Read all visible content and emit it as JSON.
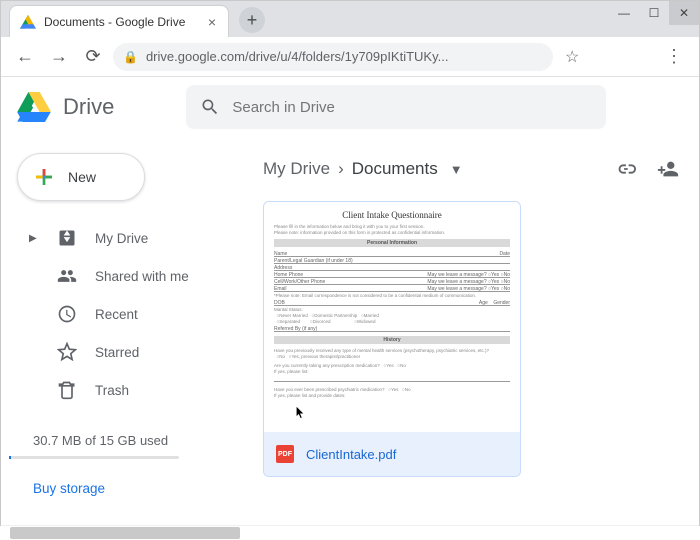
{
  "browser": {
    "tab_title": "Documents - Google Drive",
    "url": "drive.google.com/drive/u/4/folders/1y709pIKtiTUKy...",
    "new_tab_glyph": "+",
    "tab_close_glyph": "×"
  },
  "app": {
    "name": "Drive",
    "search_placeholder": "Search in Drive"
  },
  "sidebar": {
    "new_label": "New",
    "items": [
      {
        "label": "My Drive",
        "icon": "drive-icon",
        "has_caret": true
      },
      {
        "label": "Shared with me",
        "icon": "people-icon"
      },
      {
        "label": "Recent",
        "icon": "clock-icon"
      },
      {
        "label": "Starred",
        "icon": "star-icon"
      },
      {
        "label": "Trash",
        "icon": "trash-icon"
      }
    ],
    "storage_text": "30.7 MB of 15 GB used",
    "buy_storage": "Buy storage"
  },
  "breadcrumb": {
    "root": "My Drive",
    "separator": "›",
    "current": "Documents"
  },
  "toolbar_icons": {
    "link": "link-icon",
    "share": "person-add-icon"
  },
  "file": {
    "name": "ClientIntake.pdf",
    "badge": "PDF",
    "preview_title": "Client Intake Questionnaire",
    "preview_section1": "Personal Information",
    "preview_section2": "History"
  }
}
